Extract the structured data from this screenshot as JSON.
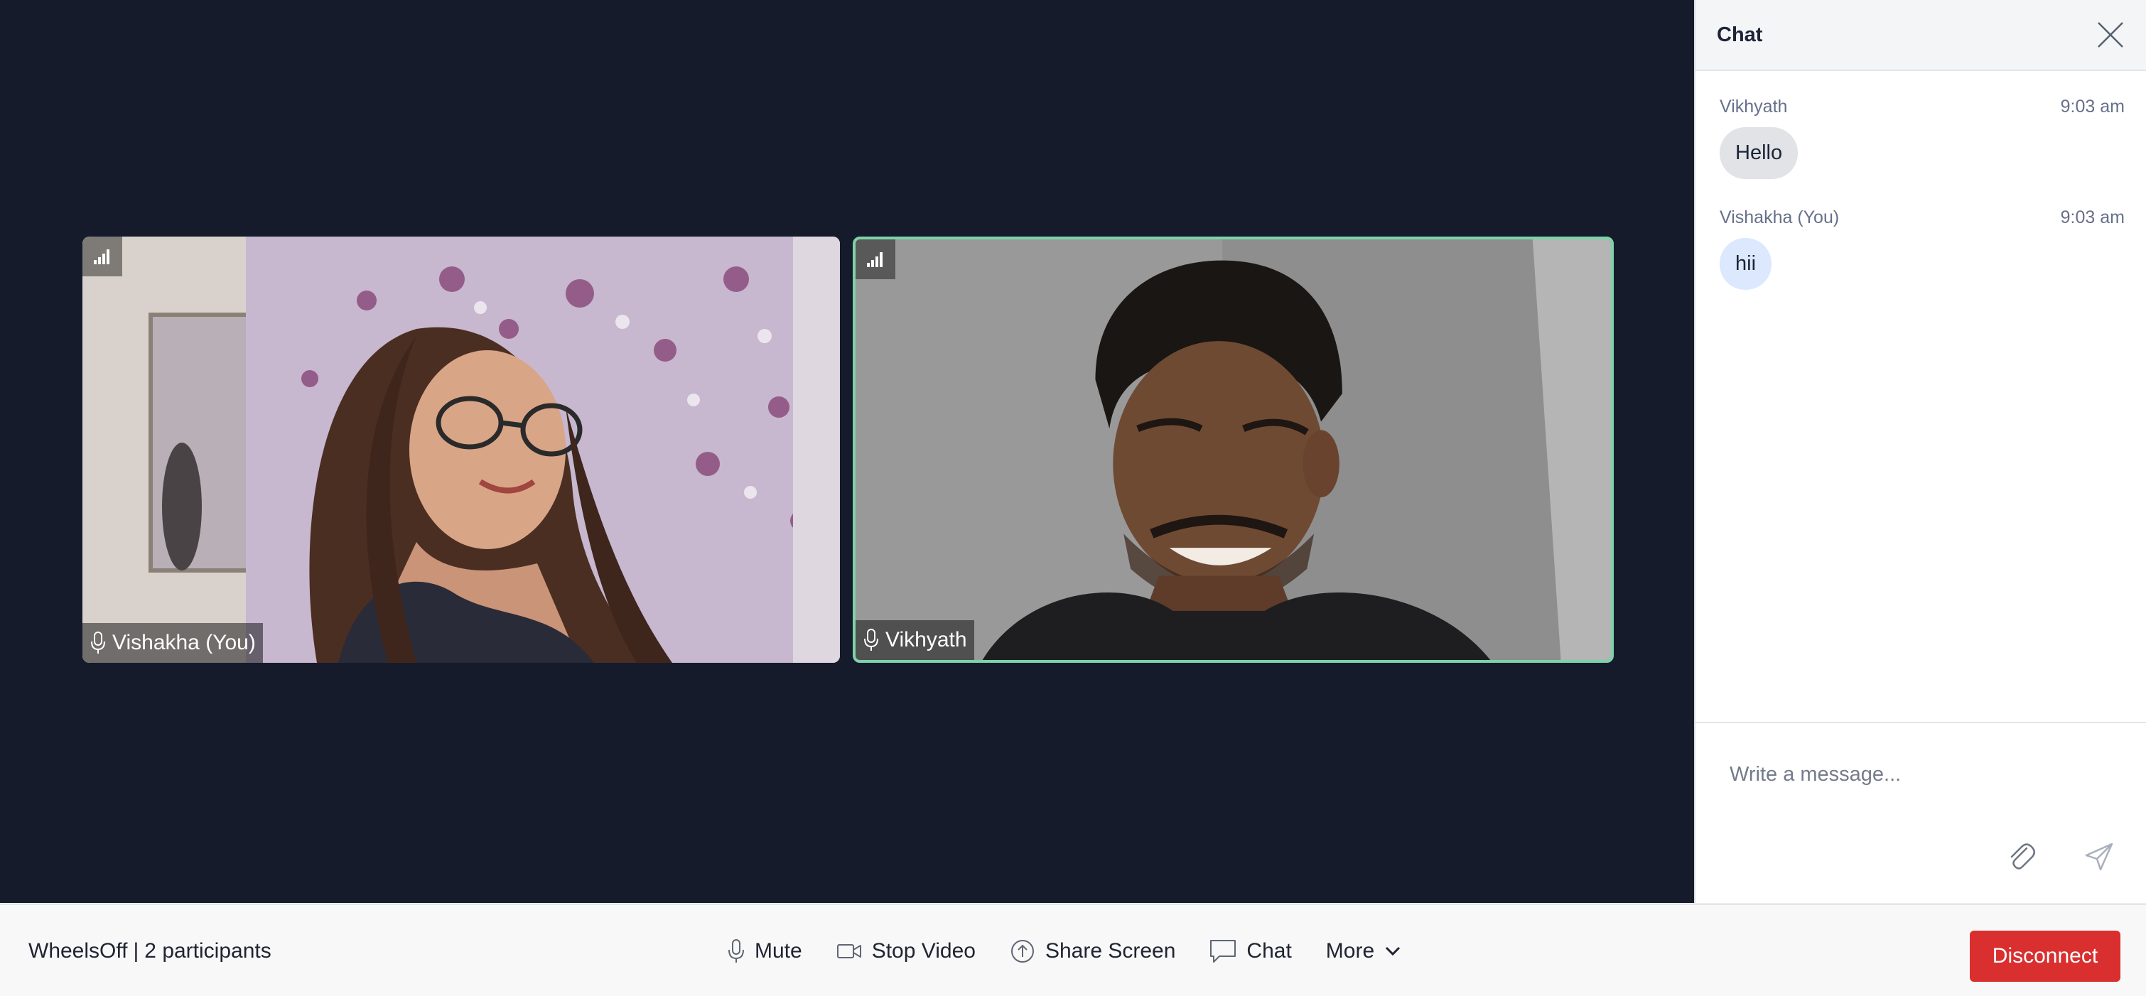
{
  "colors": {
    "stage_background": "#151b2b",
    "active_speaker_border": "#7dd3a8",
    "disconnect": "#d92f2f",
    "my_bubble": "#dbe8fd",
    "their_bubble": "#e1e3e7"
  },
  "participants": [
    {
      "name": "Vishakha (You)",
      "mic_icon": "microphone-icon",
      "signal_icon": "signal-bars-icon",
      "active_speaker": false
    },
    {
      "name": "Vikhyath",
      "mic_icon": "microphone-icon",
      "signal_icon": "signal-bars-icon",
      "active_speaker": true
    }
  ],
  "chat": {
    "title": "Chat",
    "close_icon": "close-icon",
    "messages": [
      {
        "sender": "Vikhyath",
        "time": "9:03 am",
        "text": "Hello",
        "mine": false
      },
      {
        "sender": "Vishakha (You)",
        "time": "9:03 am",
        "text": "hii",
        "mine": true
      }
    ],
    "composer": {
      "placeholder": "Write a message...",
      "value": "",
      "attach_icon": "paperclip-icon",
      "send_icon": "send-icon"
    }
  },
  "bottombar": {
    "room_name": "WheelsOff",
    "separator": "|",
    "participants_text": "2 participants",
    "controls": [
      {
        "label": "Mute",
        "icon": "microphone-icon"
      },
      {
        "label": "Stop Video",
        "icon": "video-camera-icon"
      },
      {
        "label": "Share Screen",
        "icon": "share-screen-icon"
      },
      {
        "label": "Chat",
        "icon": "chat-bubble-icon"
      },
      {
        "label": "More",
        "icon": "chevron-down-icon"
      }
    ],
    "disconnect_label": "Disconnect"
  }
}
